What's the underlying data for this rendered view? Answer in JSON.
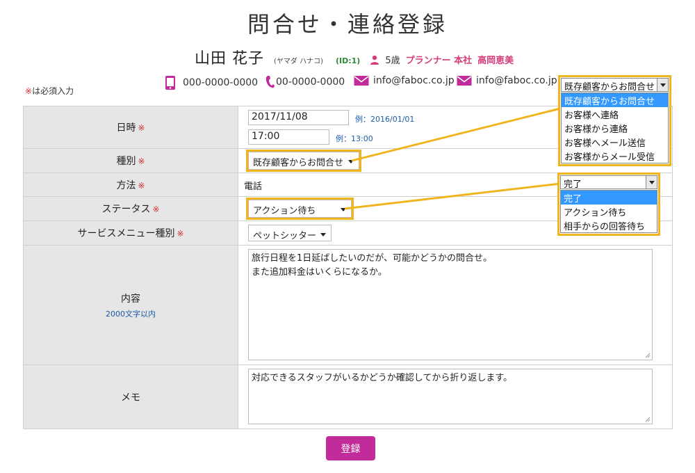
{
  "page": {
    "title": "問合せ・連絡登録"
  },
  "person": {
    "name": "山田 花子",
    "kana": "(ヤマダ ハナコ)",
    "id": "(ID:1)",
    "age": "5歳",
    "role": "プランナー 本社",
    "rep": "高岡恵美"
  },
  "required_note": {
    "mark": "※",
    "text": "は必須入力"
  },
  "contacts": {
    "mobile": "000-0000-0000",
    "phone": "00-0000-0000",
    "email1": "info@faboc.co.jp",
    "email2": "info@faboc.co.jp"
  },
  "form": {
    "required_mark": "※",
    "datetime": {
      "label": "日時",
      "date": "2017/11/08",
      "date_hint": "例：2016/01/01",
      "time": "17:00",
      "time_hint": "例：13:00"
    },
    "type": {
      "label": "種別",
      "value": "既存顧客からお問合せ"
    },
    "method": {
      "label": "方法",
      "value": "電話"
    },
    "status": {
      "label": "ステータス",
      "value": "アクション待ち"
    },
    "service": {
      "label": "サービスメニュー種別",
      "value": "ペットシッター"
    },
    "content": {
      "label": "内容",
      "sublabel": "2000文字以内",
      "value": "旅行日程を1日延ばしたいのだが、可能かどうかの問合せ。\nまた追加料金はいくらになるか。"
    },
    "memo": {
      "label": "メモ",
      "value": "対応できるスタッフがいるかどうか確認してから折り返します。"
    },
    "submit_label": "登録"
  },
  "type_dropdown": {
    "selected": "既存顧客からお問合せ",
    "options": [
      "既存顧客からお問合せ",
      "お客様へ連絡",
      "お客様から連絡",
      "お客様へメール送信",
      "お客様からメール受信"
    ]
  },
  "status_dropdown": {
    "selected": "完了",
    "options": [
      "完了",
      "アクション待ち",
      "相手からの回答待ち"
    ]
  },
  "colors": {
    "accent": "#c12c9a",
    "highlight": "#f0b41c",
    "required": "#d62d2d",
    "pink_icon": "#d63c7a"
  }
}
